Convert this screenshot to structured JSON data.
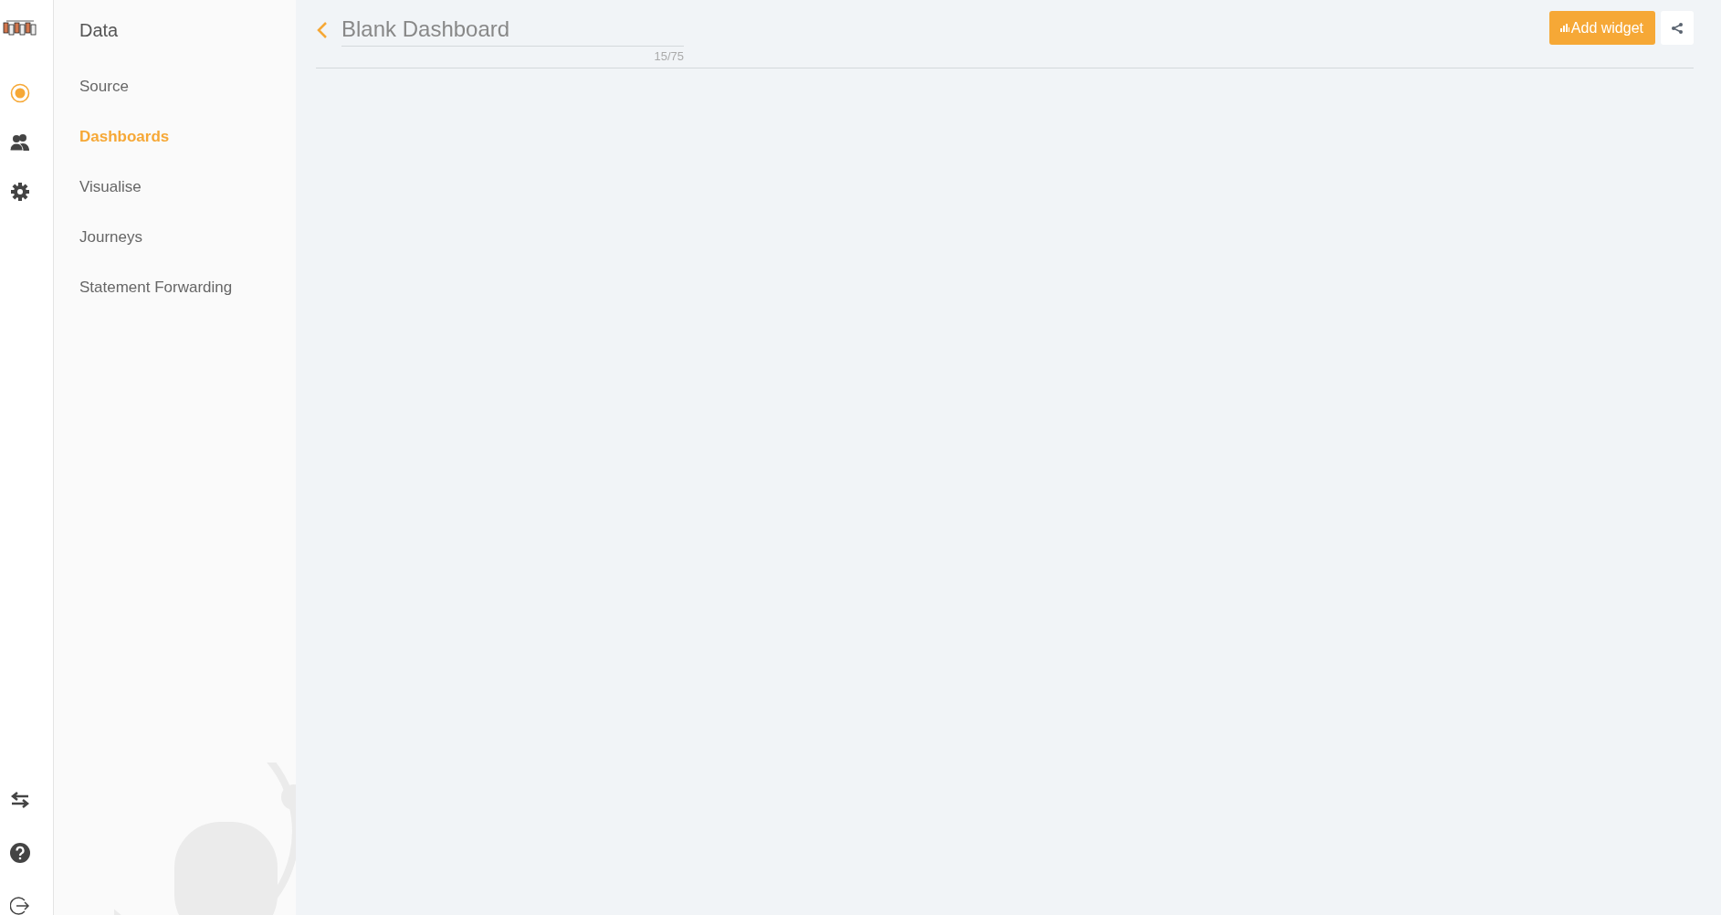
{
  "rail": {
    "top": [
      {
        "kind": "target",
        "selected": true
      },
      {
        "kind": "users",
        "selected": false
      },
      {
        "kind": "gear",
        "selected": false
      }
    ],
    "bottom": [
      {
        "kind": "swap"
      },
      {
        "kind": "help"
      },
      {
        "kind": "logout"
      }
    ]
  },
  "sidebar": {
    "title": "Data",
    "items": [
      {
        "label": "Source",
        "selected": false
      },
      {
        "label": "Dashboards",
        "selected": true
      },
      {
        "label": "Visualise",
        "selected": false
      },
      {
        "label": "Journeys",
        "selected": false
      },
      {
        "label": "Statement Forwarding",
        "selected": false
      }
    ]
  },
  "header": {
    "title": {
      "value": "Blank Dashboard",
      "counter": "15/75"
    },
    "add_button": "Add widget"
  }
}
